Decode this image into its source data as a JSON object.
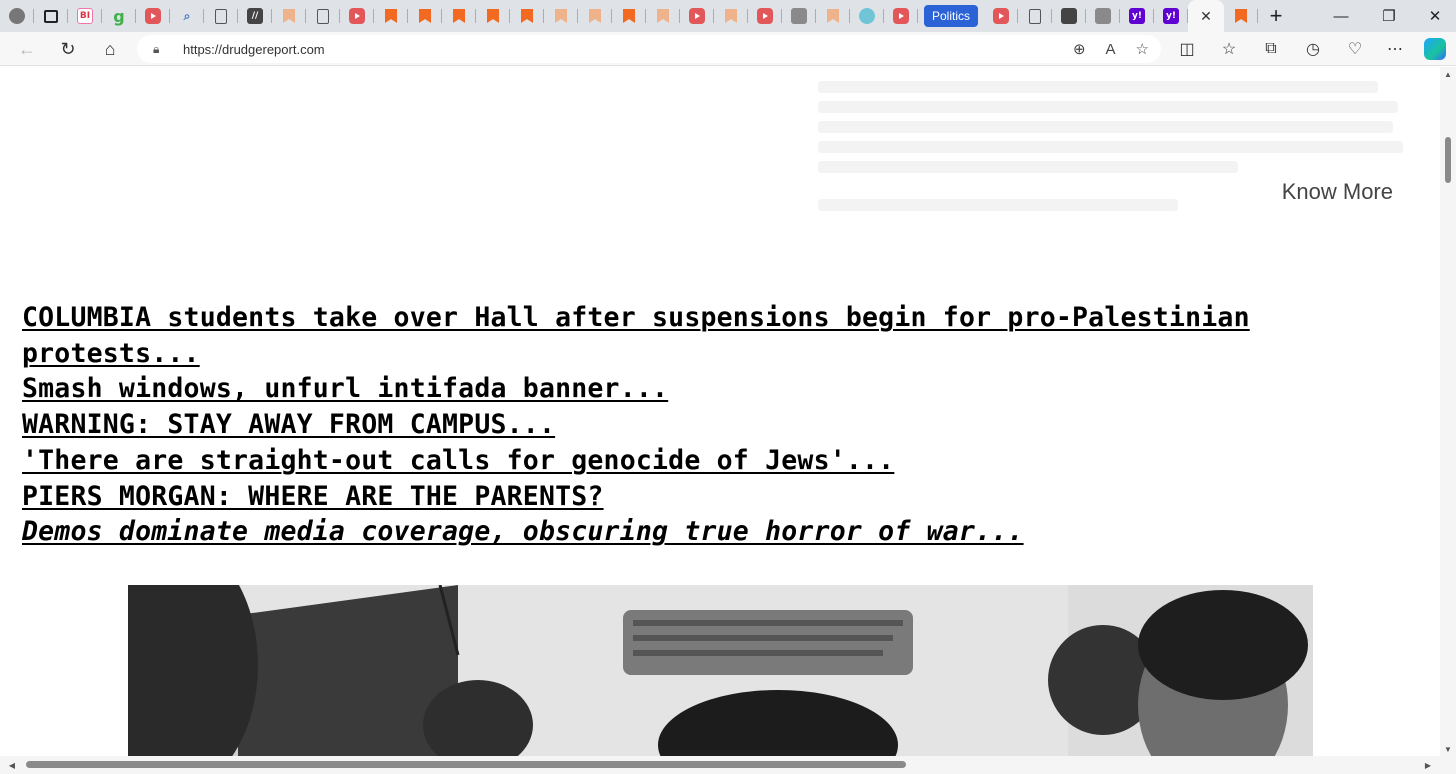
{
  "browser": {
    "tabs": [
      {
        "icon": "profile-icon",
        "kind": "profile"
      },
      {
        "icon": "tab-actions-icon",
        "kind": "actions"
      },
      {
        "icon": "bi-icon",
        "kind": "bi",
        "glyph": "BI"
      },
      {
        "icon": "grammarly-icon",
        "kind": "green",
        "glyph": "g"
      },
      {
        "icon": "podcast-icon",
        "kind": "red"
      },
      {
        "icon": "search-icon",
        "kind": "search",
        "glyph": "⌕"
      },
      {
        "icon": "document-icon",
        "kind": "doc"
      },
      {
        "icon": "link-icon",
        "kind": "dark",
        "glyph": "//"
      },
      {
        "icon": "bookmark-icon",
        "kind": "peach"
      },
      {
        "icon": "document-icon",
        "kind": "doc"
      },
      {
        "icon": "video-icon",
        "kind": "red"
      },
      {
        "icon": "bookmark-icon",
        "kind": "orange"
      },
      {
        "icon": "bookmark-icon",
        "kind": "orange"
      },
      {
        "icon": "bookmark-icon",
        "kind": "orange"
      },
      {
        "icon": "bookmark-icon",
        "kind": "orange"
      },
      {
        "icon": "bookmark-icon",
        "kind": "orange"
      },
      {
        "icon": "bookmark-icon",
        "kind": "peach"
      },
      {
        "icon": "bookmark-icon",
        "kind": "peach"
      },
      {
        "icon": "bookmark-icon",
        "kind": "orange"
      },
      {
        "icon": "bookmark-icon",
        "kind": "peach"
      },
      {
        "icon": "video-icon",
        "kind": "red"
      },
      {
        "icon": "bookmark-icon",
        "kind": "peach"
      },
      {
        "icon": "video-icon",
        "kind": "red"
      },
      {
        "icon": "news-icon",
        "kind": "gray"
      },
      {
        "icon": "bookmark-icon",
        "kind": "peach"
      },
      {
        "icon": "chat-icon",
        "kind": "teal"
      },
      {
        "icon": "video-icon",
        "kind": "red"
      }
    ],
    "politics_tab": "Politics",
    "tabs_after": [
      {
        "icon": "video-icon",
        "kind": "red"
      },
      {
        "icon": "document-icon",
        "kind": "doc"
      },
      {
        "icon": "image-icon",
        "kind": "dark"
      },
      {
        "icon": "globe-icon",
        "kind": "gray"
      },
      {
        "icon": "yahoo-icon",
        "kind": "purple",
        "glyph": "y!"
      },
      {
        "icon": "yahoo-icon",
        "kind": "purple",
        "glyph": "y!"
      }
    ],
    "active_tab_close": "✕",
    "tab_after_active": {
      "icon": "bookmark-icon",
      "kind": "orange"
    },
    "new_tab": "+",
    "url": "https://drudgereport.com"
  },
  "ad": {
    "know_more": "Know More"
  },
  "headlines": [
    {
      "text": "COLUMBIA students take over Hall after suspensions begin for pro-Palestinian protests...",
      "italic": false
    },
    {
      "text": "Smash windows, unfurl intifada banner...",
      "italic": false
    },
    {
      "text": "WARNING: STAY AWAY FROM CAMPUS...",
      "italic": false
    },
    {
      "text": "'There are straight-out calls for genocide of Jews'...",
      "italic": false
    },
    {
      "text": "PIERS MORGAN: WHERE ARE THE PARENTS?",
      "italic": false
    },
    {
      "text": "Demos dominate media coverage, obscuring true horror of war...",
      "italic": true
    }
  ],
  "colors": {
    "tabstrip": "#dfe3e8",
    "politics_tab": "#2b62d6",
    "headline": "#000000"
  }
}
